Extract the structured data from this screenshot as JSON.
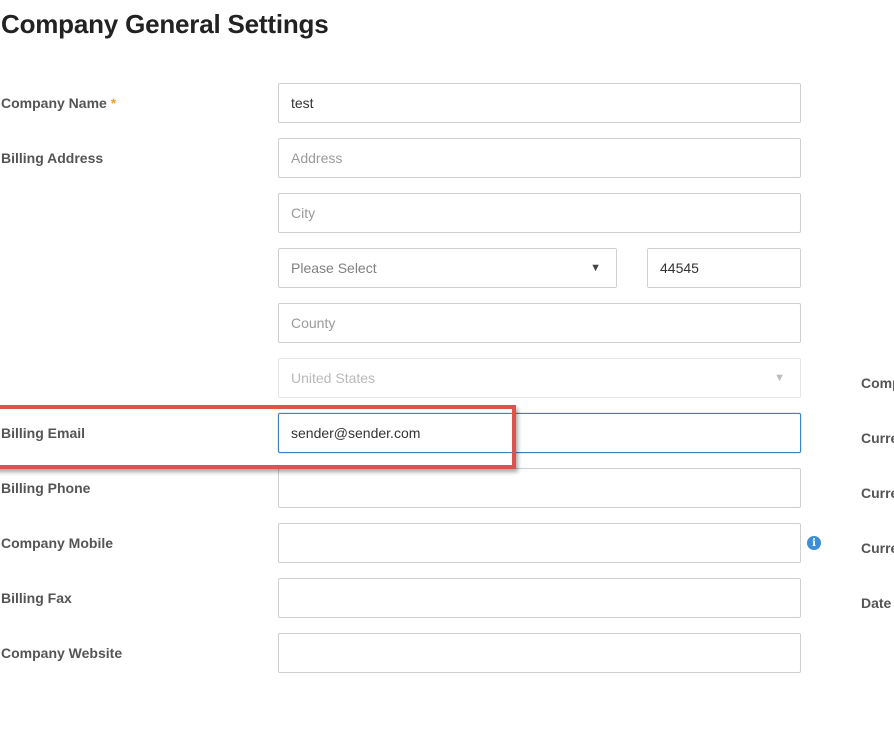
{
  "page": {
    "title": "Company General Settings"
  },
  "form": {
    "company_name": {
      "label": "Company Name",
      "required_mark": "*",
      "value": "test"
    },
    "billing_address": {
      "label": "Billing Address",
      "address": {
        "value": "",
        "placeholder": "Address"
      },
      "city": {
        "value": "",
        "placeholder": "City"
      },
      "state": {
        "selected": "Please Select"
      },
      "zip": {
        "value": "44545",
        "placeholder": ""
      },
      "county": {
        "value": "",
        "placeholder": "County"
      },
      "country": {
        "selected": "United States",
        "disabled": true
      }
    },
    "billing_email": {
      "label": "Billing Email",
      "value": "sender@sender.com"
    },
    "billing_phone": {
      "label": "Billing Phone",
      "value": ""
    },
    "company_mobile": {
      "label": "Company Mobile",
      "value": "",
      "info_icon": "info-icon"
    },
    "billing_fax": {
      "label": "Billing Fax",
      "value": ""
    },
    "company_website": {
      "label": "Company Website",
      "value": ""
    }
  },
  "right_column": {
    "labels": [
      "Comp",
      "Curre",
      "Curre",
      "Curre",
      "Date"
    ]
  },
  "annotation": {
    "highlight_color": "#d9534f",
    "focus_color": "#3b82c4",
    "required_color": "#e7a12b"
  },
  "icons": {
    "caret": "▼",
    "info": "i"
  }
}
